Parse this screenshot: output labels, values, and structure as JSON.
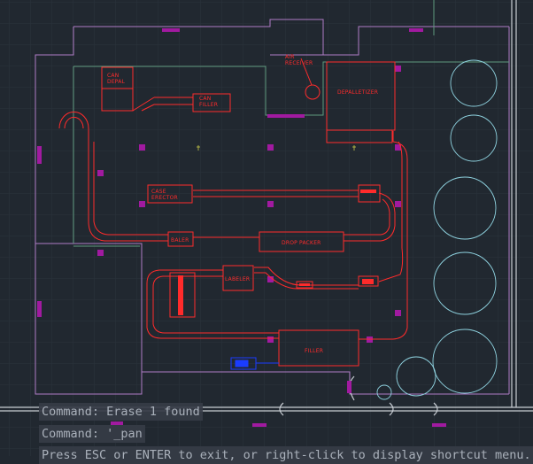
{
  "drawing": {
    "equipment": {
      "can_depal": "CAN\nDEPAL",
      "can_filler": "CAN\nFILLER",
      "air_receiver": "AIR\nRECEIVER",
      "depalletizer": "DEPALLETIZER",
      "case_erector": "CASE\nERECTOR",
      "baler": "BALER",
      "drop_packer": "DROP PACKER",
      "labeler": "LABELER",
      "filler": "FILLER"
    }
  },
  "command_line": {
    "history": [
      "Command: Erase 1 found",
      "Command: '_pan"
    ],
    "prompt": "Press ESC or ENTER to exit, or right-click to display shortcut menu."
  },
  "colors": {
    "background": "#212830",
    "equipment": "#ff2b2b",
    "walls": "#b07cc6",
    "tanks": "#8fd3e0",
    "highlight": "#1a3cff"
  }
}
